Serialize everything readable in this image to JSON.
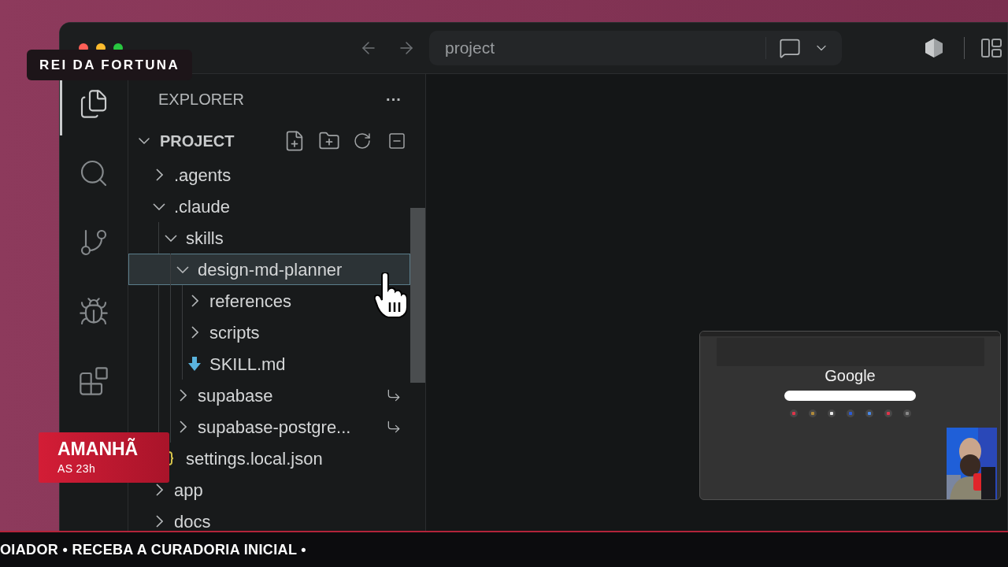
{
  "window": {
    "search_box": {
      "value": "project"
    }
  },
  "activity_bar": [
    {
      "kind": "files",
      "selected": true
    },
    {
      "kind": "search",
      "selected": false
    },
    {
      "kind": "source-control",
      "selected": false
    },
    {
      "kind": "run-debug",
      "selected": false
    },
    {
      "kind": "extensions",
      "selected": false
    }
  ],
  "explorer": {
    "title": "EXPLORER",
    "more": "···",
    "root": {
      "name": "PROJECT",
      "expanded": true
    },
    "tree": [
      {
        "name": ".agents",
        "kind": "folder",
        "expanded": false,
        "selected": false,
        "symlink": false
      },
      {
        "name": ".claude",
        "kind": "folder",
        "expanded": true,
        "selected": false,
        "symlink": false,
        "children": [
          {
            "name": "skills",
            "kind": "folder",
            "expanded": true,
            "selected": false,
            "symlink": false,
            "children": [
              {
                "name": "design-md-planner",
                "kind": "folder",
                "expanded": true,
                "selected": true,
                "symlink": false,
                "children": [
                  {
                    "name": "references",
                    "kind": "folder",
                    "expanded": false,
                    "selected": false,
                    "symlink": false
                  },
                  {
                    "name": "scripts",
                    "kind": "folder",
                    "expanded": false,
                    "selected": false,
                    "symlink": false
                  },
                  {
                    "name": "SKILL.md",
                    "kind": "markdown",
                    "selected": false,
                    "symlink": false
                  }
                ]
              },
              {
                "name": "supabase",
                "kind": "folder",
                "expanded": false,
                "selected": false,
                "symlink": true
              },
              {
                "name": "supabase-postgre...",
                "kind": "folder",
                "expanded": false,
                "selected": false,
                "symlink": true
              }
            ]
          },
          {
            "name": "settings.local.json",
            "kind": "json",
            "selected": false,
            "symlink": false
          }
        ]
      },
      {
        "name": "app",
        "kind": "folder",
        "expanded": false,
        "selected": false,
        "symlink": false
      },
      {
        "name": "docs",
        "kind": "folder",
        "expanded": false,
        "selected": false,
        "symlink": false
      }
    ]
  },
  "screen_share": {
    "logo": "Google"
  },
  "overlays": {
    "name_tag": "REI DA FORTUNA",
    "badge": {
      "title": "AMANHÃ",
      "subtitle": "AS 23h"
    },
    "ticker": "OIADOR • RECEBA A CURADORIA INICIAL •"
  }
}
